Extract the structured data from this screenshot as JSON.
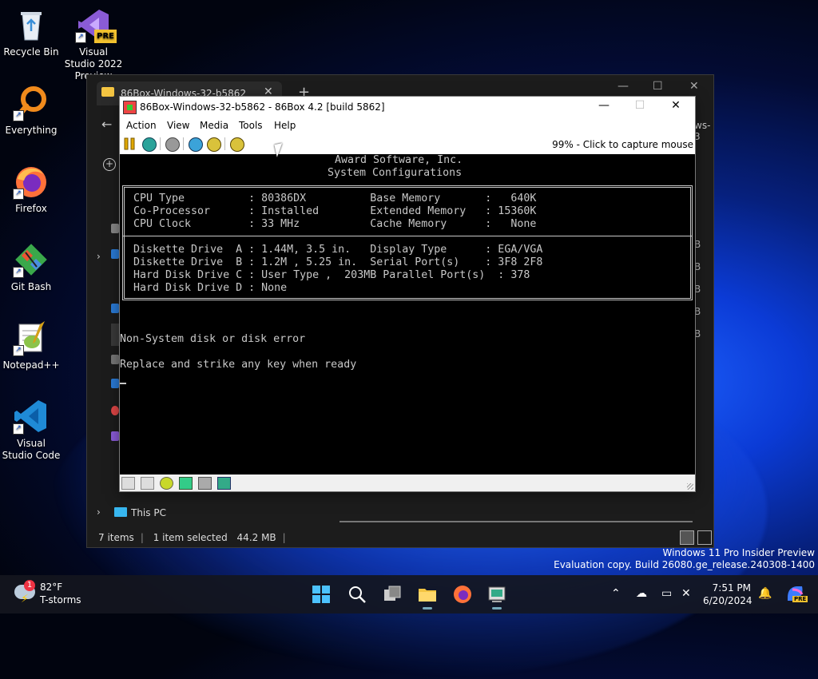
{
  "desktop": {
    "icons": [
      {
        "label": "Recycle Bin"
      },
      {
        "label": "Visual Studio 2022 Preview",
        "badge": "PRE"
      },
      {
        "label": "Everything"
      },
      {
        "label": "Firefox"
      },
      {
        "label": "Git Bash"
      },
      {
        "label": "Notepad++"
      },
      {
        "label": "Visual Studio Code"
      }
    ]
  },
  "explorer": {
    "tab_title": "86Box-Windows-32-b5862",
    "tab_close": "✕",
    "new_tab": "+",
    "minimize": "—",
    "maximize": "☐",
    "close": "✕",
    "back": "←",
    "address_fragment": "ws-3",
    "new_button": "+",
    "side_rows": [
      "B",
      "B",
      "B",
      "B",
      "B"
    ],
    "nav_this_pc": "This PC",
    "status_items": "7 items",
    "status_selected": "1 item selected",
    "status_size": "44.2 MB"
  },
  "box86": {
    "title": "86Box-Windows-32-b5862 - 86Box 4.2 [build 5862]",
    "min": "—",
    "max": "☐",
    "close": "✕",
    "menu": [
      "Action",
      "View",
      "Media",
      "Tools",
      "Help"
    ],
    "capture_text": "99% - Click to capture mouse",
    "screen": {
      "header1": "Award Software, Inc.",
      "header2": "System Configurations",
      "rows": [
        "CPU Type          : 80386DX          Base Memory       :   640K",
        "Co-Processor      : Installed        Extended Memory   : 15360K",
        "CPU Clock         : 33 MHz           Cache Memory      :   None",
        "Diskette Drive  A : 1.44M, 3.5 in.   Display Type      : EGA/VGA",
        "Diskette Drive  B : 1.2M , 5.25 in.  Serial Port(s)    : 3F8 2F8",
        "Hard Disk Drive C : User Type ,  203MB Parallel Port(s)  : 378",
        "Hard Disk Drive D : None"
      ],
      "message1": "Non-System disk or disk error",
      "message2": "Replace and strike any key when ready"
    }
  },
  "watermark": {
    "line1": "Windows 11 Pro Insider Preview",
    "line2": "Evaluation copy. Build 26080.ge_release.240308-1400"
  },
  "taskbar": {
    "weather_temp": "82°F",
    "weather_desc": "T-storms",
    "weather_badge": "1",
    "tray_chevron": "^",
    "time": "7:51 PM",
    "date": "6/20/2024",
    "copilot_badge": "PRE"
  },
  "colors": {
    "bios_text": "#c8c8c8",
    "explorer_bg": "#1c1c1c",
    "taskbar_bg": "#14161e",
    "accent": "#1f63ff"
  }
}
